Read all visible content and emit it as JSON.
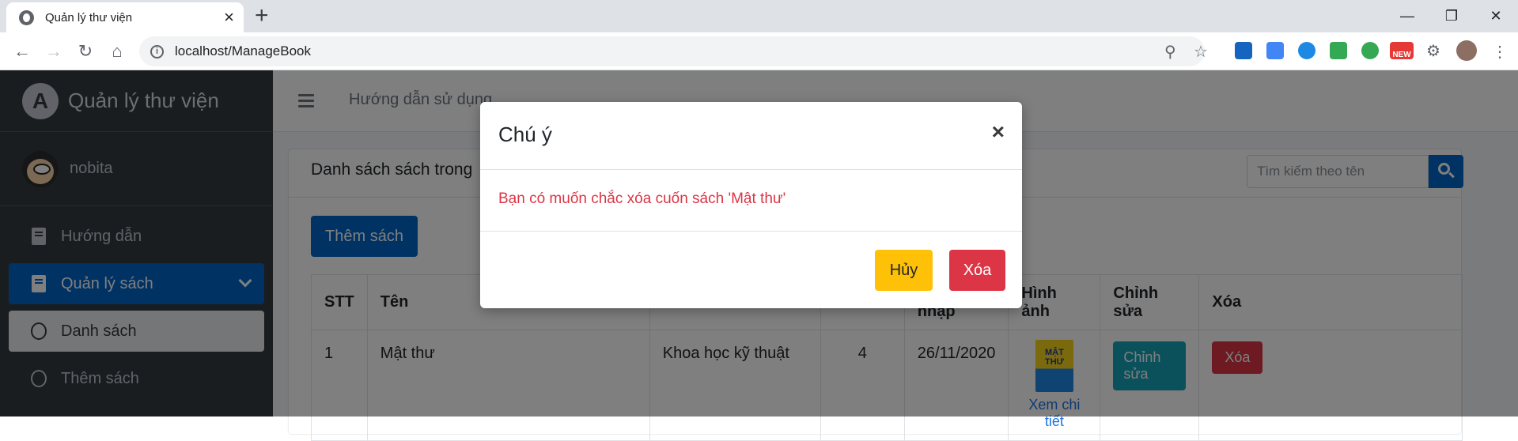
{
  "browser": {
    "tab_title": "Quản lý thư viện",
    "url": "localhost/ManageBook",
    "ext_badge": "NEW"
  },
  "sidebar": {
    "brand": "Quản lý thư viện",
    "username": "nobita",
    "items": [
      {
        "label": "Hướng dẫn"
      },
      {
        "label": "Quản lý sách"
      },
      {
        "label": "Danh sách"
      },
      {
        "label": "Thêm sách"
      }
    ]
  },
  "topnav": {
    "link": "Hướng dẫn sử dụng"
  },
  "card": {
    "title": "Danh sách sách trong",
    "search_placeholder": "Tìm kiếm theo tên",
    "add_button": "Thêm sách"
  },
  "table": {
    "headers": [
      "STT",
      "Tên",
      "",
      "",
      "Ngày nhập",
      "Hình ảnh",
      "Chỉnh sửa",
      "Xóa"
    ],
    "rows": [
      {
        "stt": "1",
        "name": "Mật thư",
        "category": "Khoa học kỹ thuật",
        "quantity": "4",
        "date": "26/11/2020",
        "cover_text": "MẬT THƯ",
        "detail_link": "Xem chi tiết",
        "edit": "Chỉnh sửa",
        "delete": "Xóa"
      }
    ]
  },
  "modal": {
    "title": "Chú ý",
    "close": "×",
    "message": "Bạn có muốn chắc xóa cuốn sách 'Mật thư'",
    "cancel": "Hủy",
    "confirm": "Xóa"
  },
  "colors": {
    "primary": "#0064c8",
    "sidebar_bg": "#343a40",
    "danger": "#dc3545",
    "warning": "#ffc107",
    "info": "#17a2b8"
  }
}
